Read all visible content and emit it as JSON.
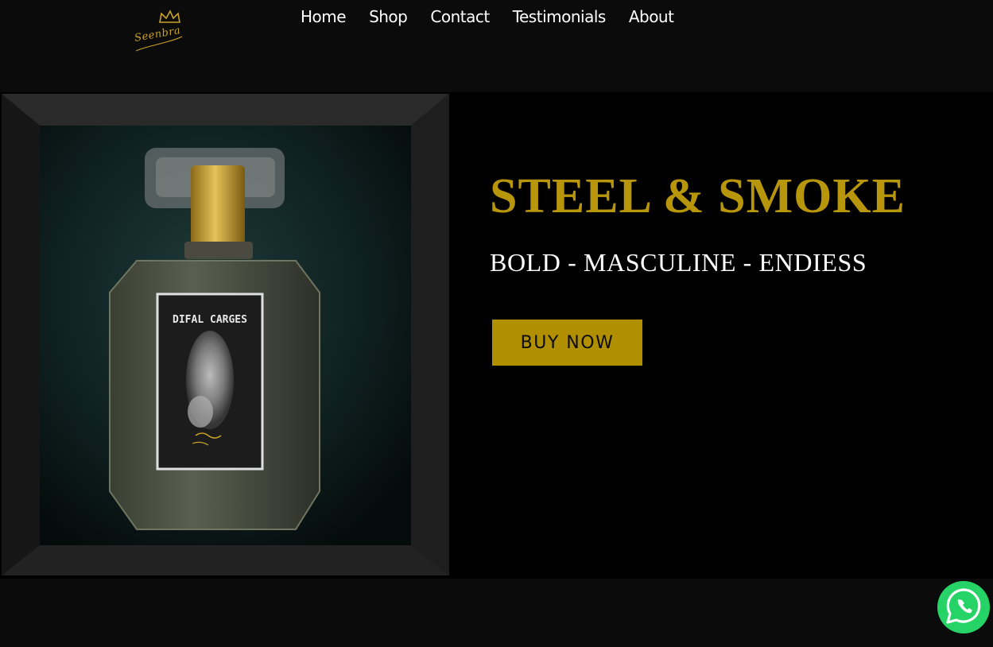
{
  "brand": {
    "logo_text": "Seenbra"
  },
  "nav": {
    "items": [
      {
        "label": "Home"
      },
      {
        "label": "Shop"
      },
      {
        "label": "Contact"
      },
      {
        "label": "Testimonials"
      },
      {
        "label": "About"
      }
    ]
  },
  "hero": {
    "title": "STEEL & SMOKE",
    "subtitle": "BOLD - MASCULINE - ENDIESS",
    "button_label": "BUY NOW",
    "product_label": "DIFAL CARGES"
  },
  "colors": {
    "background": "#0b0b0b",
    "hero_background": "#000000",
    "accent_gold": "#b8960b",
    "button_gold": "#b08f00",
    "whatsapp_green": "#25d366"
  },
  "icons": {
    "logo": "crown-signature-logo",
    "chat": "whatsapp-icon"
  }
}
